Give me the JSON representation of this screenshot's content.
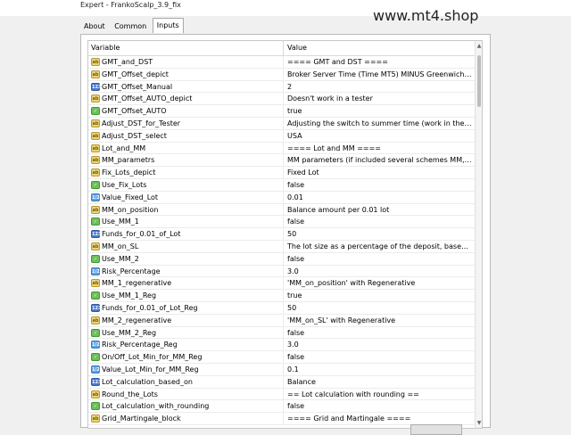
{
  "window": {
    "title": "Expert - FrankoScalp_3.9_fix"
  },
  "watermark": "www.mt4.shop",
  "tabs": [
    {
      "label": "About"
    },
    {
      "label": "Common"
    },
    {
      "label": "Inputs"
    }
  ],
  "grid": {
    "headers": {
      "variable": "Variable",
      "value": "Value"
    },
    "rows": [
      {
        "icon": "ab",
        "icon_name": "string-icon",
        "name": "GMT_and_DST",
        "value": "==== GMT and DST ===="
      },
      {
        "icon": "ab",
        "icon_name": "string-icon",
        "name": "GMT_Offset_depict",
        "value": "Broker Server Time (Time MT5) MINUS  Greenwich M..."
      },
      {
        "icon": "num",
        "icon_name": "integer-icon",
        "name": "GMT_Offset_Manual",
        "value": "2"
      },
      {
        "icon": "ab",
        "icon_name": "string-icon",
        "name": "GMT_Offset_AUTO_depict",
        "value": "Doesn't work in a tester"
      },
      {
        "icon": "bool",
        "icon_name": "bool-icon",
        "name": "GMT_Offset_AUTO",
        "value": "true"
      },
      {
        "icon": "ab",
        "icon_name": "string-icon",
        "name": "Adjust_DST_for_Tester",
        "value": "Adjusting the switch to summer time (work in the strat..."
      },
      {
        "icon": "ab",
        "icon_name": "string-icon",
        "name": "Adjust_DST_select",
        "value": "USA"
      },
      {
        "icon": "ab",
        "icon_name": "string-icon",
        "name": "Lot_and_MM",
        "value": "==== Lot and MM ===="
      },
      {
        "icon": "ab",
        "icon_name": "string-icon",
        "name": "MM_parametrs",
        "value": "MM parameters (if included several schemes MM, the ..."
      },
      {
        "icon": "ab",
        "icon_name": "string-icon",
        "name": "Fix_Lots_depict",
        "value": "Fixed Lot"
      },
      {
        "icon": "bool",
        "icon_name": "bool-icon",
        "name": "Use_Fix_Lots",
        "value": "false"
      },
      {
        "icon": "dbl",
        "icon_name": "double-icon",
        "name": "Value_Fixed_Lot",
        "value": "0.01"
      },
      {
        "icon": "ab",
        "icon_name": "string-icon",
        "name": "MM_on_position",
        "value": "Balance amount per 0.01 lot"
      },
      {
        "icon": "bool",
        "icon_name": "bool-icon",
        "name": "Use_MM_1",
        "value": "false"
      },
      {
        "icon": "num",
        "icon_name": "integer-icon",
        "name": "Funds_for_0.01_of_Lot",
        "value": "50"
      },
      {
        "icon": "ab",
        "icon_name": "string-icon",
        "name": "MM_on_SL",
        "value": "The lot size as a percentage of the deposit, based on ..."
      },
      {
        "icon": "bool",
        "icon_name": "bool-icon",
        "name": "Use_MM_2",
        "value": "false"
      },
      {
        "icon": "dbl",
        "icon_name": "double-icon",
        "name": "Risk_Percentage",
        "value": "3.0"
      },
      {
        "icon": "ab",
        "icon_name": "string-icon",
        "name": "MM_1_regenerative",
        "value": "'MM_on_position' with Regenerative"
      },
      {
        "icon": "bool",
        "icon_name": "bool-icon",
        "name": "Use_MM_1_Reg",
        "value": "true"
      },
      {
        "icon": "num",
        "icon_name": "integer-icon",
        "name": "Funds_for_0.01_of_Lot_Reg",
        "value": "50"
      },
      {
        "icon": "ab",
        "icon_name": "string-icon",
        "name": "MM_2_regenerative",
        "value": "'MM_on_SL' with Regenerative"
      },
      {
        "icon": "bool",
        "icon_name": "bool-icon",
        "name": "Use_MM_2_Reg",
        "value": "false"
      },
      {
        "icon": "dbl",
        "icon_name": "double-icon",
        "name": "Risk_Percentage_Reg",
        "value": "3.0"
      },
      {
        "icon": "bool",
        "icon_name": "bool-icon",
        "name": "On/Off_Lot_Min_for_MM_Reg",
        "value": "false"
      },
      {
        "icon": "dbl",
        "icon_name": "double-icon",
        "name": "Value_Lot_Min_for_MM_Reg",
        "value": "0.1"
      },
      {
        "icon": "num",
        "icon_name": "integer-icon",
        "name": "Lot_calculation_based_on",
        "value": "Balance"
      },
      {
        "icon": "ab",
        "icon_name": "string-icon",
        "name": "Round_the_Lots",
        "value": "== Lot calculation with rounding =="
      },
      {
        "icon": "bool",
        "icon_name": "bool-icon",
        "name": "Lot_calculation_with_rounding",
        "value": "false"
      },
      {
        "icon": "ab",
        "icon_name": "string-icon",
        "name": "Grid_Martingale_block",
        "value": "==== Grid and Martingale ===="
      }
    ]
  },
  "icon_glyphs": {
    "ab": "ab",
    "num": "123",
    "dbl": "1/2",
    "bool": "✓"
  }
}
